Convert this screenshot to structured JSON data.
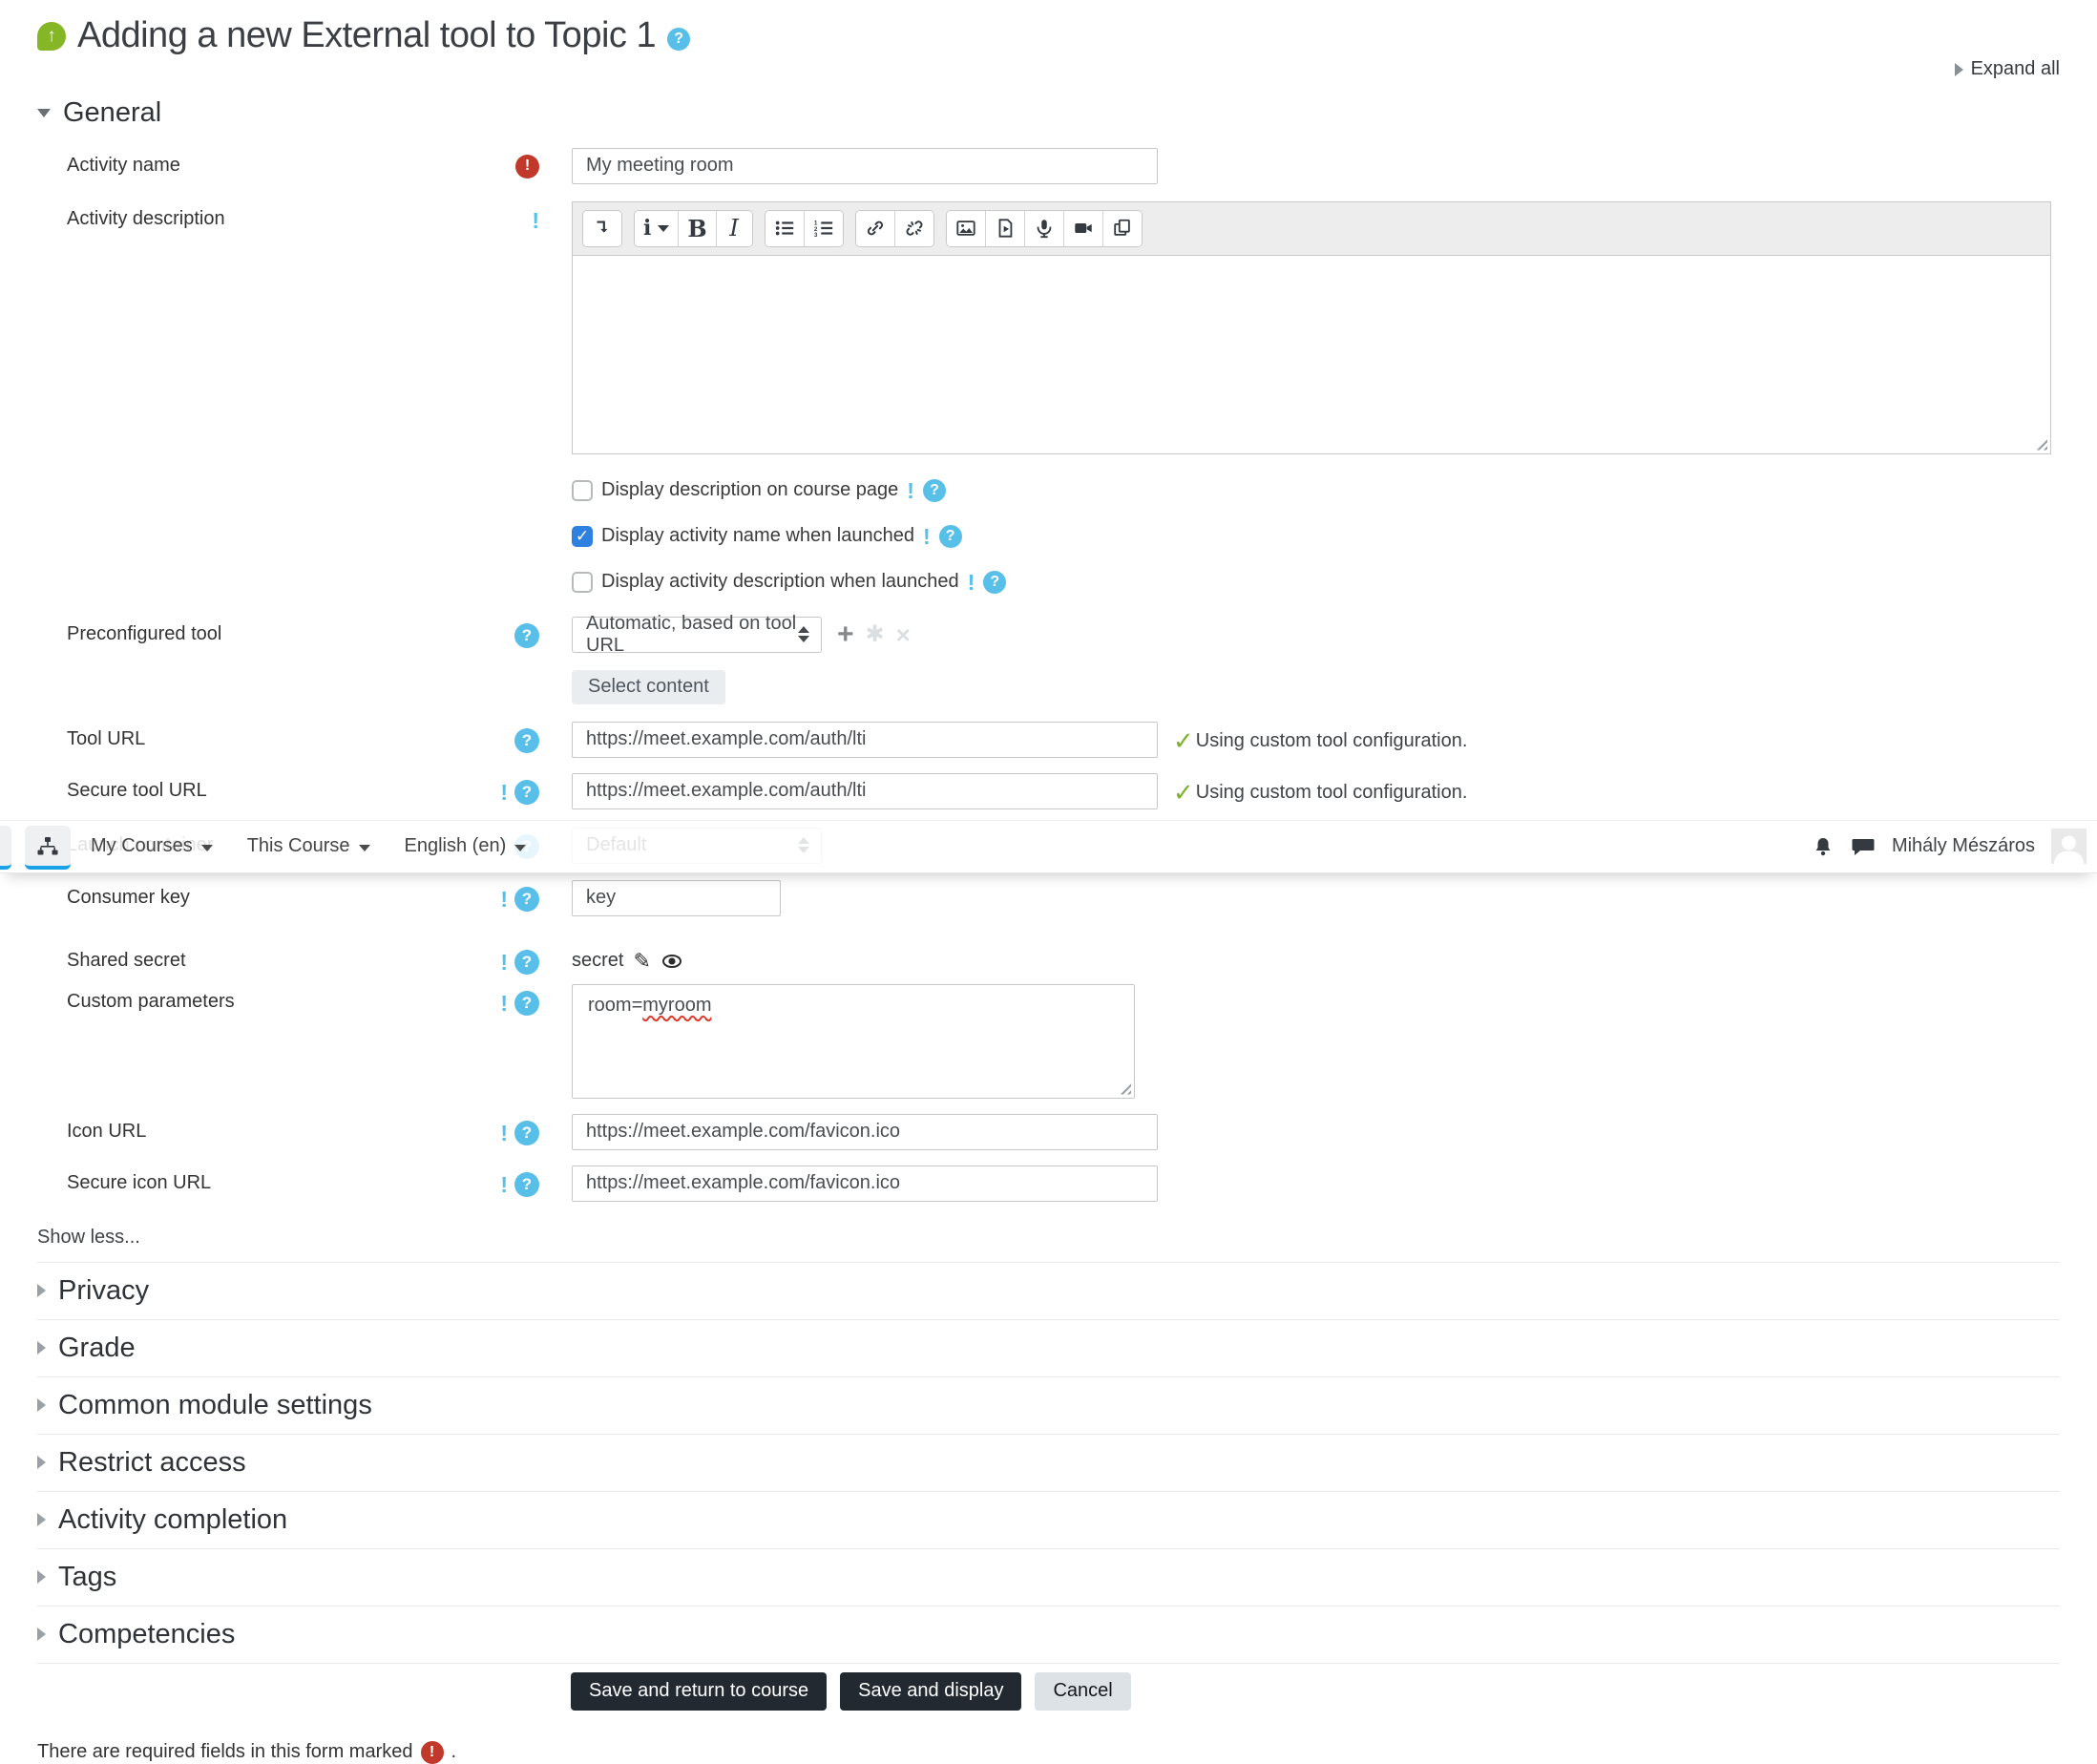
{
  "page": {
    "title": "Adding a new External tool to Topic 1",
    "expand_all": "Expand all",
    "show_less": "Show less...",
    "required_note": "There are required fields in this form marked",
    "required_note_suffix": "."
  },
  "navbar": {
    "items": [
      "My Courses",
      "This Course",
      "English (en)"
    ],
    "user_name": "Mihály Mészáros",
    "icons": [
      "sitemap-icon",
      "bell-icon",
      "chat-icon",
      "avatar"
    ]
  },
  "general": {
    "heading": "General"
  },
  "fields": {
    "activity_name": {
      "label": "Activity name",
      "value": "My meeting room",
      "required": true
    },
    "activity_description": {
      "label": "Activity description"
    },
    "preconfigured_tool": {
      "label": "Preconfigured tool",
      "value": "Automatic, based on tool URL",
      "button": "Select content"
    },
    "tool_url": {
      "label": "Tool URL",
      "value": "https://meet.example.com/auth/lti",
      "status": "Using custom tool configuration."
    },
    "secure_tool_url": {
      "label": "Secure tool URL",
      "value": "https://meet.example.com/auth/lti",
      "status": "Using custom tool configuration."
    },
    "launch_container": {
      "label": "Launch container",
      "value": "Default"
    },
    "consumer_key": {
      "label": "Consumer key",
      "value": "key"
    },
    "shared_secret": {
      "label": "Shared secret",
      "value": "secret"
    },
    "custom_parameters": {
      "label": "Custom parameters",
      "value_prefix": "room=",
      "value_misspelled": "myroom"
    },
    "icon_url": {
      "label": "Icon URL",
      "value": "https://meet.example.com/favicon.ico"
    },
    "secure_icon_url": {
      "label": "Secure icon URL",
      "value": "https://meet.example.com/favicon.ico"
    }
  },
  "checkboxes": [
    {
      "label": "Display description on course page",
      "checked": false
    },
    {
      "label": "Display activity name when launched",
      "checked": true
    },
    {
      "label": "Display activity description when launched",
      "checked": false
    }
  ],
  "editor": {
    "glyphs": {
      "styles": "i",
      "bold": "B",
      "italic": "I"
    },
    "toolbar_icons": [
      "collapse-toolbar-icon",
      "paragraph-styles-icon",
      "bold-icon",
      "italic-icon",
      "unordered-list-icon",
      "ordered-list-icon",
      "link-icon",
      "unlink-icon",
      "image-icon",
      "media-icon",
      "record-audio-icon",
      "record-video-icon",
      "manage-files-icon"
    ]
  },
  "sections": [
    "Privacy",
    "Grade",
    "Common module settings",
    "Restrict access",
    "Activity completion",
    "Tags",
    "Competencies"
  ],
  "actions": {
    "save_return": "Save and return to course",
    "save_display": "Save and display",
    "cancel": "Cancel"
  },
  "colors": {
    "help_blue": "#57bfe8",
    "required_red": "#c0392b",
    "check_green": "#7db32a",
    "module_green": "#84b626",
    "checkbox_blue": "#2f81e0",
    "nav_active_blue": "#1aa2e8",
    "dark_button": "#222930"
  }
}
